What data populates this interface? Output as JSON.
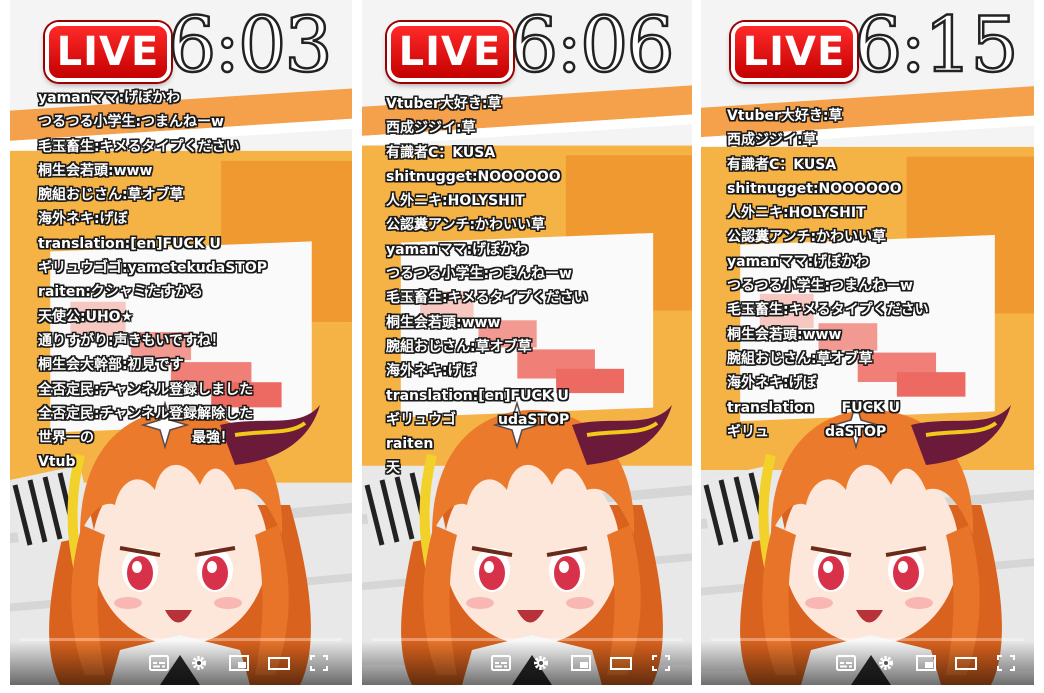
{
  "panels": [
    {
      "live": "LIVE",
      "time": "6:03",
      "chat": [
        "yamanママ:げぼかわ",
        "つるつる小学生:つまんねーw",
        "毛玉畜生:キメるタイプください",
        "桐生会若頭:www",
        "腕組おじさん:草オブ草",
        "海外ネキ:げぼ",
        "translation:[en]FUCK U",
        "ギリュウゴゴ:yametekudaSTOP",
        "raiten:クシャミたすかる",
        "天使公:UHO★",
        "通りすがり:声きもいですね！",
        "桐生会大幹部:初見です",
        "全否定民:チャンネル登録しました",
        "全否定民:チャンネル登録解除した",
        "世界一の　　　　　　　最強！",
        "Vtub"
      ]
    },
    {
      "live": "LIVE",
      "time": "6:06",
      "chat": [
        "Vtuber大好き:草",
        "西成ジジイ:草",
        "有識者C：KUSA",
        "shitnugget:NOOOOOO",
        "人外ニキ:HOLYSHIT",
        "公認糞アンチ:かわいい草",
        "yamanママ:げぼかわ",
        "つるつる小学生:つまんねーw",
        "毛玉畜生:キメるタイプください",
        "桐生会若頭:www",
        "腕組おじさん:草オブ草",
        "海外ネキ:げぼ",
        "translation:[en]FUCK U",
        "ギリュウゴ　　　udaSTOP",
        "raiten",
        "天"
      ]
    },
    {
      "live": "LIVE",
      "time": "6:15",
      "chat": [
        "Vtuber大好き:草",
        "西成ジジイ:草",
        "有識者C：KUSA",
        "shitnugget:NOOOOOO",
        "人外ニキ:HOLYSHIT",
        "公認糞アンチ:かわいい草",
        "yamanママ:げぼかわ",
        "つるつる小学生:つまんねーw",
        "毛玉畜生:キメるタイプください",
        "桐生会若頭:www",
        "腕組おじさん:草オブ草",
        "海外ネキ:げぼ",
        "translation　　FUCK U",
        "ギリュ　　　　daSTOP"
      ]
    }
  ],
  "controls": {
    "icons": [
      "subtitles-icon",
      "settings-gear-icon",
      "miniplayer-icon",
      "theater-mode-icon",
      "fullscreen-icon"
    ]
  },
  "colors": {
    "live_red": "#e00000",
    "accent_orange": "#f2a43a",
    "hair_orange": "#e8742a",
    "horn_purple": "#6b1a3a"
  }
}
